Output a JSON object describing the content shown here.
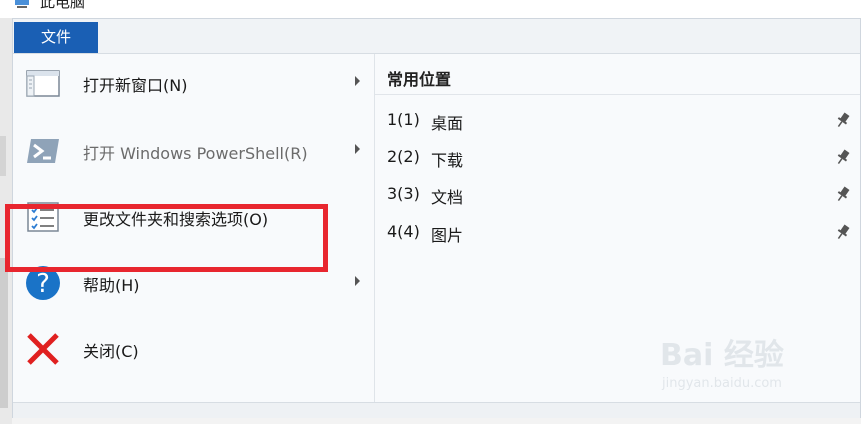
{
  "window": {
    "title": "此电脑"
  },
  "menubar": {
    "file_tab": "文件"
  },
  "file_menu": {
    "items": [
      {
        "label": "打开新窗口(N)",
        "icon": "new-window-icon",
        "has_submenu": true,
        "enabled": true
      },
      {
        "label": "打开 Windows PowerShell(R)",
        "icon": "powershell-icon",
        "has_submenu": true,
        "enabled": false
      },
      {
        "label": "更改文件夹和搜索选项(O)",
        "icon": "folder-options-icon",
        "has_submenu": false,
        "enabled": true,
        "highlighted": true
      },
      {
        "label": "帮助(H)",
        "icon": "help-icon",
        "has_submenu": true,
        "enabled": true
      },
      {
        "label": "关闭(C)",
        "icon": "close-icon",
        "has_submenu": false,
        "enabled": true
      }
    ]
  },
  "frequent_places": {
    "title": "常用位置",
    "items": [
      {
        "number": "1(1)",
        "name": "桌面",
        "pinned": true
      },
      {
        "number": "2(2)",
        "name": "下载",
        "pinned": true
      },
      {
        "number": "3(3)",
        "name": "文档",
        "pinned": true
      },
      {
        "number": "4(4)",
        "name": "图片",
        "pinned": true
      }
    ]
  },
  "watermark": {
    "main": "Bai 经验",
    "sub": "jingyan.baidu.com"
  },
  "colors": {
    "accent": "#1a5fb4",
    "highlight_border": "#e8262f",
    "help_icon": "#1a73c7",
    "close_icon": "#e02020"
  }
}
